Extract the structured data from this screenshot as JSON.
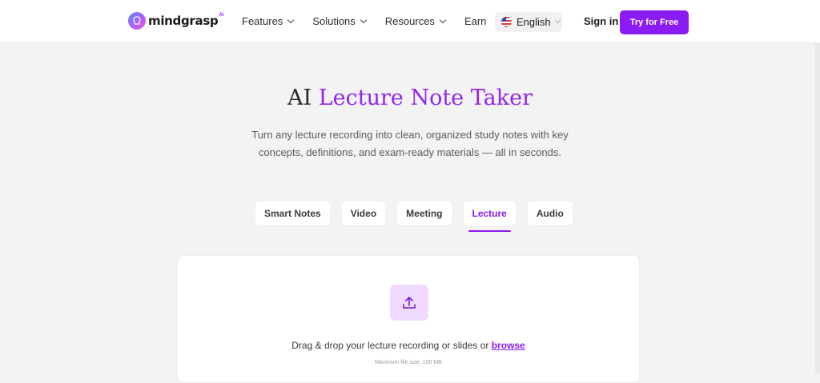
{
  "header": {
    "logo_text": "mindgrasp",
    "logo_sup": "AI",
    "nav": [
      {
        "label": "Features"
      },
      {
        "label": "Solutions"
      },
      {
        "label": "Resources"
      },
      {
        "label": "Earn"
      }
    ],
    "language": "English",
    "sign_in": "Sign in",
    "cta": "Try for Free"
  },
  "hero": {
    "title_plain": "AI ",
    "title_accent": "Lecture Note Taker",
    "subtitle": "Turn any lecture recording into clean, organized study notes with key concepts, definitions, and exam-ready materials — all in seconds."
  },
  "tabs": [
    {
      "label": "Smart Notes",
      "active": false
    },
    {
      "label": "Video",
      "active": false
    },
    {
      "label": "Meeting",
      "active": false
    },
    {
      "label": "Lecture",
      "active": true
    },
    {
      "label": "Audio",
      "active": false
    }
  ],
  "upload": {
    "drop_text": "Drag & drop your lecture recording or slides or ",
    "browse": "browse",
    "max_size": "Maximum file size: 100 MB"
  },
  "colors": {
    "accent": "#8a1bf2",
    "title_accent": "#9524f0",
    "page_bg": "#f3f3f4"
  }
}
